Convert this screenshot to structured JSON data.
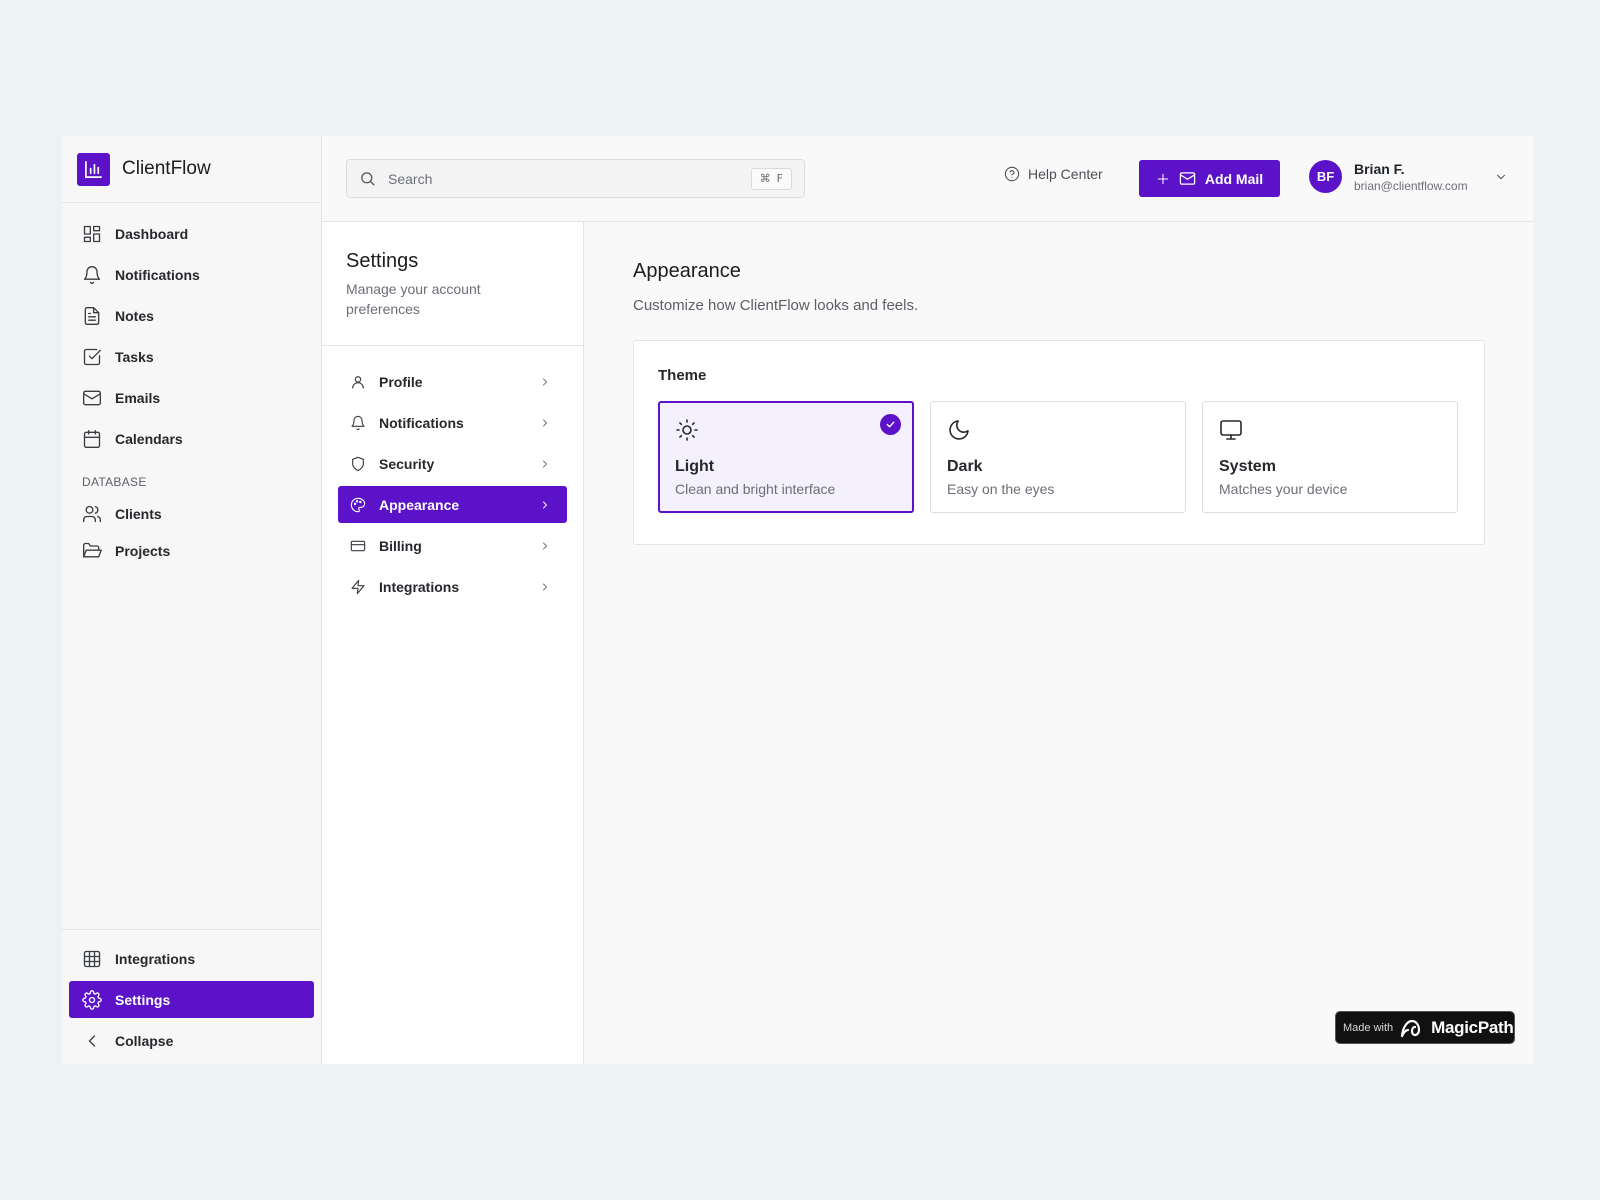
{
  "brand": {
    "name": "ClientFlow"
  },
  "sidebar": {
    "items": [
      {
        "label": "Dashboard",
        "icon": "dashboard-icon"
      },
      {
        "label": "Notifications",
        "icon": "bell-icon"
      },
      {
        "label": "Notes",
        "icon": "document-icon"
      },
      {
        "label": "Tasks",
        "icon": "checkbox-icon"
      },
      {
        "label": "Emails",
        "icon": "mail-icon"
      },
      {
        "label": "Calendars",
        "icon": "calendar-icon"
      }
    ],
    "section_label": "DATABASE",
    "db_items": [
      {
        "label": "Clients",
        "icon": "users-icon"
      },
      {
        "label": "Projects",
        "icon": "folder-icon"
      }
    ],
    "bottom_items": [
      {
        "label": "Integrations",
        "icon": "grid-icon"
      },
      {
        "label": "Settings",
        "icon": "gear-icon",
        "active": true
      },
      {
        "label": "Collapse",
        "icon": "chevron-left-icon"
      }
    ]
  },
  "topbar": {
    "search_placeholder": "Search",
    "shortcut_symbol": "⌘",
    "shortcut_key": "F",
    "help_label": "Help Center",
    "add_mail_label": "Add Mail",
    "user": {
      "initials": "BF",
      "name": "Brian F.",
      "email": "brian@clientflow.com"
    }
  },
  "settings": {
    "title": "Settings",
    "subtitle": "Manage your account preferences",
    "items": [
      {
        "label": "Profile",
        "icon": "user-icon"
      },
      {
        "label": "Notifications",
        "icon": "bell-icon"
      },
      {
        "label": "Security",
        "icon": "shield-icon"
      },
      {
        "label": "Appearance",
        "icon": "palette-icon",
        "active": true
      },
      {
        "label": "Billing",
        "icon": "credit-card-icon"
      },
      {
        "label": "Integrations",
        "icon": "lightning-icon"
      }
    ]
  },
  "appearance": {
    "title": "Appearance",
    "subtitle": "Customize how ClientFlow looks and feels.",
    "card_title": "Theme",
    "themes": [
      {
        "name": "Light",
        "desc": "Clean and bright interface",
        "icon": "sun-icon",
        "selected": true
      },
      {
        "name": "Dark",
        "desc": "Easy on the eyes",
        "icon": "moon-icon",
        "selected": false
      },
      {
        "name": "System",
        "desc": "Matches your device",
        "icon": "monitor-icon",
        "selected": false
      }
    ]
  },
  "badge": {
    "made_with": "Made with",
    "brand": "MagicPath"
  },
  "colors": {
    "accent": "#5b12c9",
    "background": "#ecf3f5",
    "selected_card_bg": "#f5f0fd"
  }
}
